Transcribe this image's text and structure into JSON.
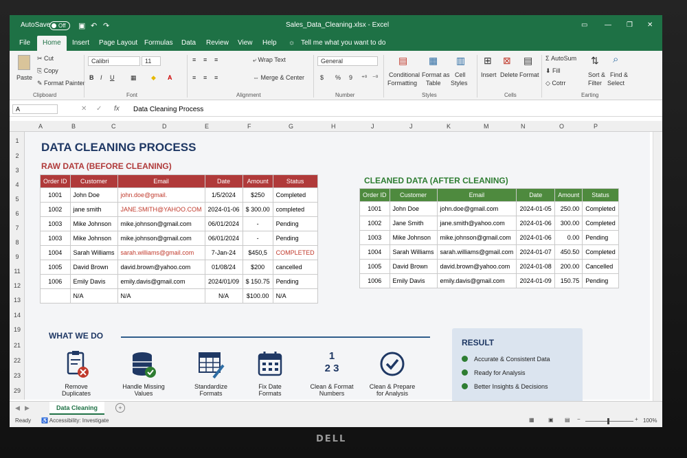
{
  "titlebar": {
    "autosave": "AutoSave",
    "toggle": "Off",
    "filename": "Sales_Data_Cleaning.xlsx - Excel"
  },
  "tabs": [
    "File",
    "Home",
    "Insert",
    "Page Layout",
    "Formulas",
    "Data",
    "Review",
    "View",
    "Help"
  ],
  "tell_me": "Tell me what you want to do",
  "ribbon": {
    "paste": "Paste",
    "cut": "Cut",
    "copy": "Copy",
    "format_painter": "Format Painter",
    "clipboard": "Clipboard",
    "font_name": "Calibri",
    "font_size": "11",
    "font_group": "Font",
    "wrap_text": "Wrap Text",
    "merge_center": "Merge & Center",
    "alignment": "Alignment",
    "number_format": "General",
    "number_group": "Number",
    "conditional": "Conditional",
    "formatting": "Formatting",
    "format_as": "Format as",
    "table": "Table",
    "cell": "Cell",
    "styles_btn": "Styles",
    "styles_group": "Styles",
    "insert": "Insert",
    "delete": "Delete",
    "format": "Format",
    "cells": "Cells",
    "autosum": "AutoSum",
    "fill": "Fill",
    "clear": "Cotrr",
    "sort": "Sort &",
    "filter": "Filter",
    "find": "Find &",
    "select": "Select",
    "editing": "Earting"
  },
  "formula_bar": {
    "namebox": "A",
    "formula": "Data Cleaning Process"
  },
  "columns": [
    "A",
    "B",
    "C",
    "D",
    "E",
    "F",
    "G",
    "H",
    "J",
    "J",
    "K",
    "M",
    "N",
    "O",
    "P"
  ],
  "rows": [
    "1",
    "2",
    "3",
    "4",
    "5",
    "6",
    "7",
    "8",
    "9",
    "11",
    "12",
    "13",
    "14",
    "19",
    "21",
    "22",
    "23",
    "29"
  ],
  "sheet": {
    "title": "DATA CLEANING PROCESS",
    "raw_heading": "RAW DATA (BEFORE CLEANING)",
    "clean_heading": "CLEANED DATA (AFTER CLEANING)",
    "headers": [
      "Order ID",
      "Customer",
      "Email",
      "Date",
      "Amount",
      "Status"
    ],
    "raw_rows": [
      [
        "1001",
        "John Doe",
        "john.doe@gmail.",
        "1/5/2024",
        "$250",
        "Completed"
      ],
      [
        "1002",
        "jane smith",
        "JANE.SMITH@YAHOO.COM",
        "2024-01-06",
        "$ 300.00",
        "completed"
      ],
      [
        "1003",
        "Mike Johnson",
        "mike.johnson@gmail.com",
        "06/01/2024",
        "-",
        "Pending"
      ],
      [
        "1003",
        "Mike Johnson",
        "mike.johnson@gmail.com",
        "06/01/2024",
        "-",
        "Pending"
      ],
      [
        "1004",
        "Sarah Williams",
        "sarah.williams@gmail.com",
        "7-Jan-24",
        "$450,5",
        "COMPLETED"
      ],
      [
        "1005",
        "David Brown",
        "david.brown@yahoo.com",
        "01/08/24",
        "$200",
        "cancelled"
      ],
      [
        "1006",
        "Emily Davis",
        "emily.davis@gmail.com",
        "2024/01/09",
        "$ 150.75",
        "Pending"
      ],
      [
        "",
        "N/A",
        "N/A",
        "N/A",
        "$100.00",
        "N/A"
      ]
    ],
    "clean_rows": [
      [
        "1001",
        "John Doe",
        "john.doe@gmail.com",
        "2024-01-05",
        "250.00",
        "Completed"
      ],
      [
        "1002",
        "Jane Smith",
        "jane.smith@yahoo.com",
        "2024-01-06",
        "300.00",
        "Completed"
      ],
      [
        "1003",
        "Mike Johnson",
        "mike.johnson@gmail.com",
        "2024-01-06",
        "0.00",
        "Pending"
      ],
      [
        "1004",
        "Sarah Williams",
        "sarah.williams@gmail.com",
        "2024-01-07",
        "450.50",
        "Completed"
      ],
      [
        "1005",
        "David Brown",
        "david.brown@yahoo.com",
        "2024-01-08",
        "200.00",
        "Cancelled"
      ],
      [
        "1006",
        "Emily Davis",
        "emily.davis@gmail.com",
        "2024-01-09",
        "150.75",
        "Pending"
      ]
    ],
    "what_we_do": "WHAT WE DO",
    "steps": [
      {
        "l1": "Remove",
        "l2": "Duplicates"
      },
      {
        "l1": "Handle Missing",
        "l2": "Values"
      },
      {
        "l1": "Standardize",
        "l2": "Formats"
      },
      {
        "l1": "Fix Date",
        "l2": "Formats"
      },
      {
        "l1": "Clean & Format",
        "l2": "Numbers"
      },
      {
        "l1": "Clean & Prepare",
        "l2": "for Analysis"
      }
    ],
    "numbers_icon": {
      "top": "1",
      "bottom": "2 3"
    },
    "result_title": "RESULT",
    "results": [
      "Accurate & Consistent Data",
      "Ready for Analysis",
      "Better Insights & Decisions"
    ]
  },
  "sheet_tab": "Data Cleaning",
  "status": {
    "ready": "Ready",
    "accessibility": "Accessibility: Investigate",
    "zoom": "100%"
  },
  "brand": "DELL",
  "colors": {
    "excel_green": "#1e7145",
    "raw_header": "#b03a3a",
    "clean_header": "#4e8a3e",
    "navy": "#1f3864",
    "raw_heading": "#b03a3a",
    "clean_heading": "#2e7d32"
  }
}
